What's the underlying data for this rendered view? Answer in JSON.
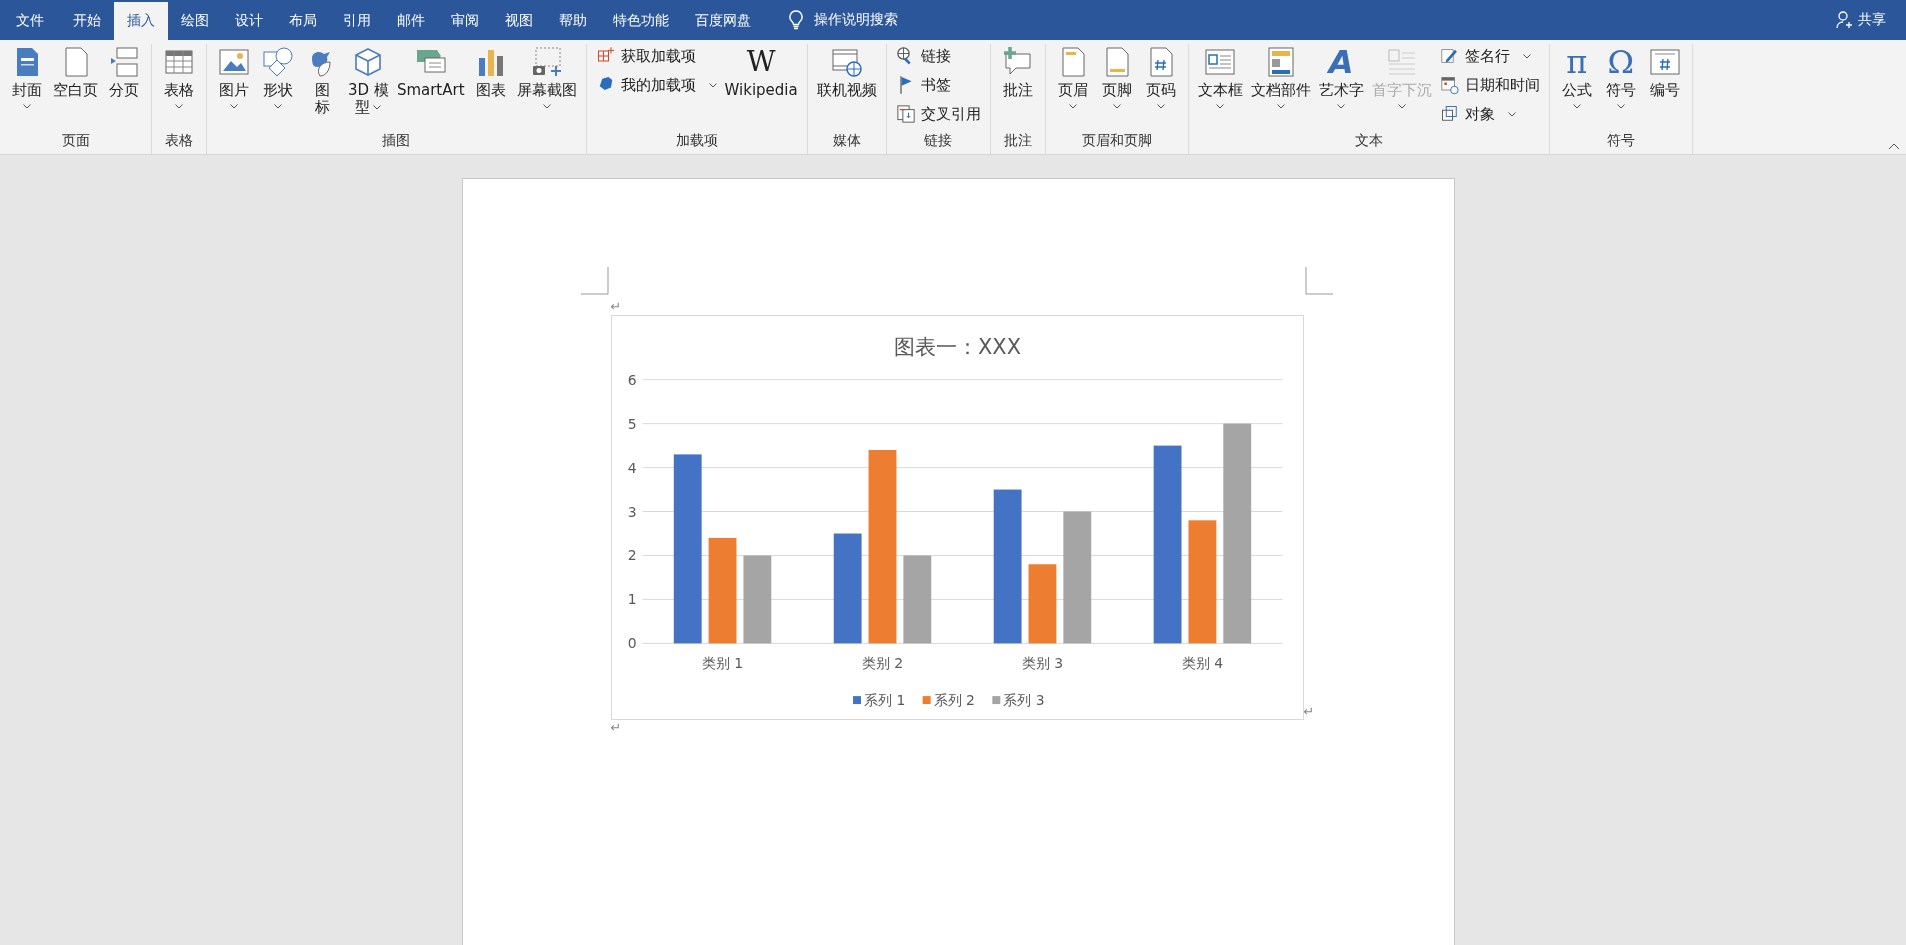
{
  "tabs": [
    {
      "label": "文件",
      "selected": false
    },
    {
      "label": "开始",
      "selected": false
    },
    {
      "label": "插入",
      "selected": true
    },
    {
      "label": "绘图",
      "selected": false
    },
    {
      "label": "设计",
      "selected": false
    },
    {
      "label": "布局",
      "selected": false
    },
    {
      "label": "引用",
      "selected": false
    },
    {
      "label": "邮件",
      "selected": false
    },
    {
      "label": "审阅",
      "selected": false
    },
    {
      "label": "视图",
      "selected": false
    },
    {
      "label": "帮助",
      "selected": false
    },
    {
      "label": "特色功能",
      "selected": false
    },
    {
      "label": "百度网盘",
      "selected": false
    }
  ],
  "search": {
    "label": "操作说明搜索"
  },
  "share": {
    "label": "共享"
  },
  "ribbon_groups": [
    {
      "label": "页面",
      "items": [
        {
          "kind": "large",
          "lines": [
            "封面"
          ],
          "dropdown": true
        },
        {
          "kind": "large",
          "lines": [
            "空白页"
          ],
          "dropdown": false
        },
        {
          "kind": "large",
          "lines": [
            "分页"
          ],
          "dropdown": false
        }
      ]
    },
    {
      "label": "表格",
      "items": [
        {
          "kind": "large",
          "lines": [
            "表格"
          ],
          "dropdown": true
        }
      ]
    },
    {
      "label": "插图",
      "items": [
        {
          "kind": "large",
          "lines": [
            "图片"
          ],
          "dropdown": true
        },
        {
          "kind": "large",
          "lines": [
            "形状"
          ],
          "dropdown": true
        },
        {
          "kind": "large",
          "lines": [
            "图",
            "标"
          ],
          "dropdown": false
        },
        {
          "kind": "large",
          "lines": [
            "3D 模",
            "型"
          ],
          "dropdown": true
        },
        {
          "kind": "large",
          "lines": [
            "SmartArt"
          ],
          "dropdown": false
        },
        {
          "kind": "large",
          "lines": [
            "图表"
          ],
          "dropdown": false
        },
        {
          "kind": "large",
          "lines": [
            "屏幕截图"
          ],
          "dropdown": true
        }
      ]
    },
    {
      "label": "加载项",
      "items": [
        {
          "kind": "stack",
          "items": [
            {
              "label": "获取加载项",
              "dropdown": false
            },
            {
              "label": "我的加载项",
              "dropdown": true
            }
          ]
        },
        {
          "kind": "large",
          "lines": [
            "Wikipedia"
          ],
          "dropdown": false,
          "glyph": "W"
        }
      ]
    },
    {
      "label": "媒体",
      "items": [
        {
          "kind": "large",
          "lines": [
            "联机视频"
          ],
          "dropdown": false
        }
      ]
    },
    {
      "label": "链接",
      "items": [
        {
          "kind": "stack",
          "items": [
            {
              "label": "链接",
              "dropdown": false
            },
            {
              "label": "书签",
              "dropdown": false
            },
            {
              "label": "交叉引用",
              "dropdown": false
            }
          ]
        }
      ]
    },
    {
      "label": "批注",
      "items": [
        {
          "kind": "large",
          "lines": [
            "批注"
          ],
          "dropdown": false
        }
      ]
    },
    {
      "label": "页眉和页脚",
      "items": [
        {
          "kind": "large",
          "lines": [
            "页眉"
          ],
          "dropdown": true
        },
        {
          "kind": "large",
          "lines": [
            "页脚"
          ],
          "dropdown": true
        },
        {
          "kind": "large",
          "lines": [
            "页码"
          ],
          "dropdown": true
        }
      ]
    },
    {
      "label": "文本",
      "items": [
        {
          "kind": "large",
          "lines": [
            "文本框"
          ],
          "dropdown": true
        },
        {
          "kind": "large",
          "lines": [
            "文档部件"
          ],
          "dropdown": true
        },
        {
          "kind": "large",
          "lines": [
            "艺术字"
          ],
          "dropdown": true,
          "glyph": "A"
        },
        {
          "kind": "large",
          "lines": [
            "首字下沉"
          ],
          "dropdown": true,
          "disabled": true
        },
        {
          "kind": "stack",
          "items": [
            {
              "label": "签名行",
              "dropdown": true
            },
            {
              "label": "日期和时间",
              "dropdown": false
            },
            {
              "label": "对象",
              "dropdown": true
            }
          ]
        }
      ]
    },
    {
      "label": "符号",
      "items": [
        {
          "kind": "large",
          "lines": [
            "公式"
          ],
          "dropdown": true,
          "glyph": "π"
        },
        {
          "kind": "large",
          "lines": [
            "符号"
          ],
          "dropdown": true,
          "glyph": "Ω"
        },
        {
          "kind": "large",
          "lines": [
            "编号"
          ],
          "dropdown": false
        }
      ]
    }
  ],
  "document": {
    "paragraph_marks": [
      "↵",
      "↵",
      "↵"
    ],
    "chart": {
      "chart_data": {
        "type": "bar",
        "title": "图表一：XXX",
        "categories": [
          "类别 1",
          "类别 2",
          "类别 3",
          "类别 4"
        ],
        "series": [
          {
            "name": "系列 1",
            "color": "#4472c4",
            "values": [
              4.3,
              2.5,
              3.5,
              4.5
            ]
          },
          {
            "name": "系列 2",
            "color": "#ed7d31",
            "values": [
              2.4,
              4.4,
              1.8,
              2.8
            ]
          },
          {
            "name": "系列 3",
            "color": "#a5a5a5",
            "values": [
              2,
              2,
              3,
              5
            ]
          }
        ],
        "ylim": [
          0,
          6
        ],
        "yticks": [
          0,
          1,
          2,
          3,
          4,
          5,
          6
        ],
        "grid": true,
        "legend": true
      }
    }
  }
}
